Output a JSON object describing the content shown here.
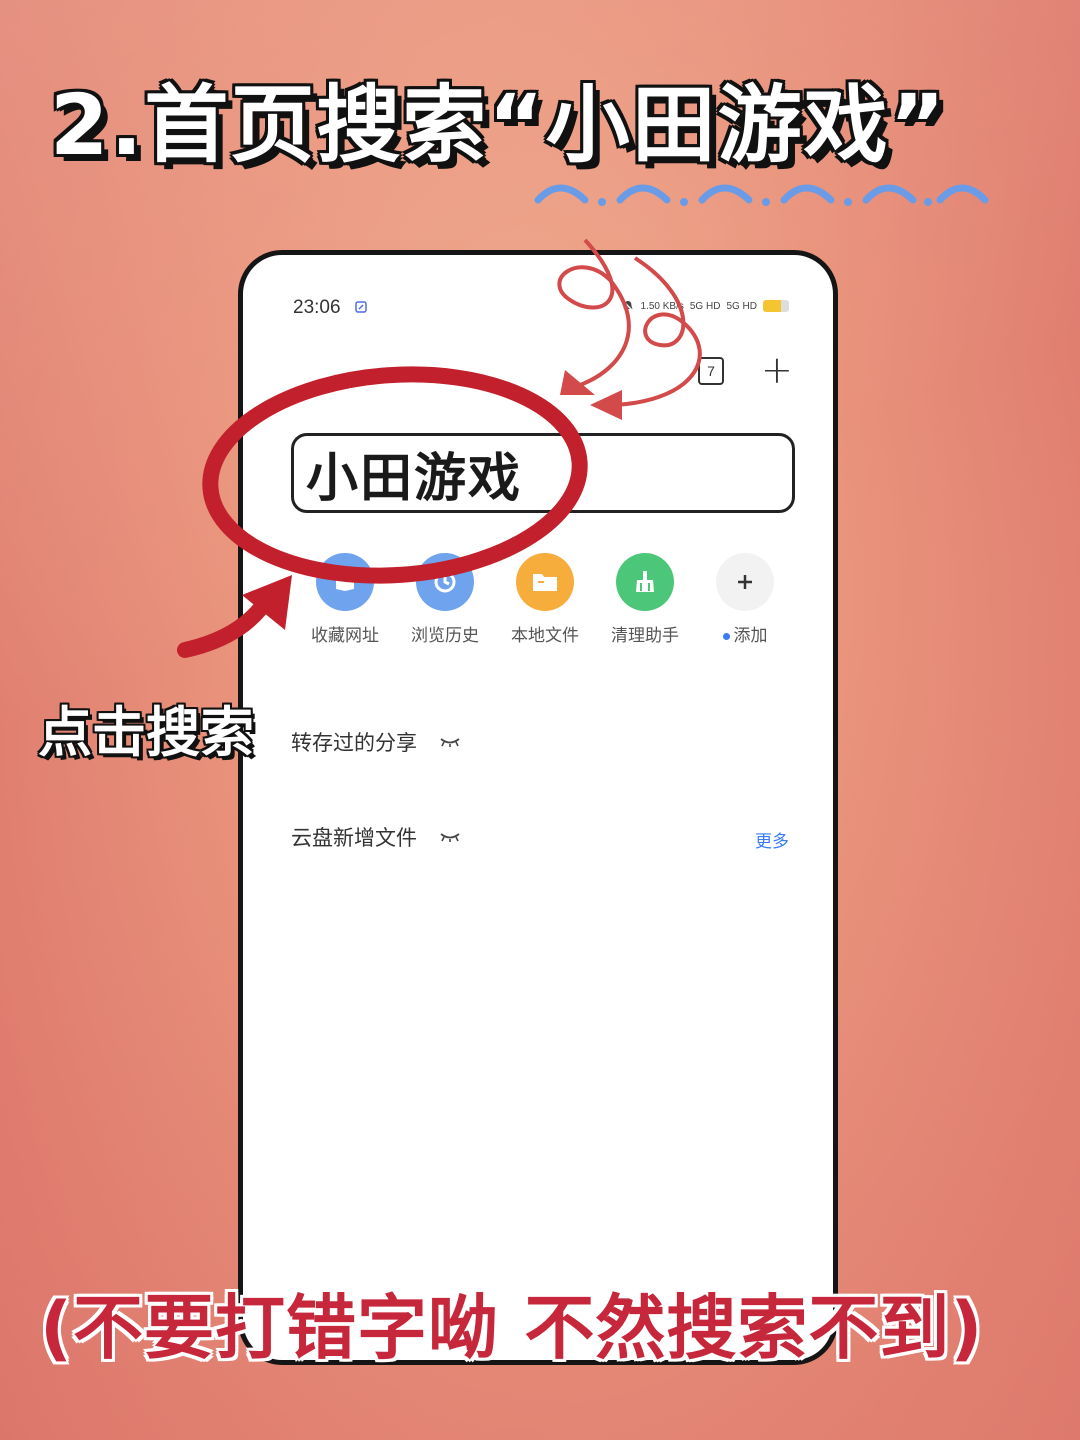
{
  "headline": {
    "title": "2.首页搜索“小田游戏”",
    "side_note": "点击搜索",
    "warning": "(不要打错字呦  不然搜索不到)"
  },
  "status_bar": {
    "time": "23:06",
    "net_speed": "1.50 KB/s",
    "sim1": "5G HD",
    "sim2": "5G HD"
  },
  "toolbar": {
    "tab_count": "7",
    "new_tab_label": "+"
  },
  "search": {
    "value": "小田游戏"
  },
  "quick_links": [
    {
      "label": "收藏网址",
      "icon": "bookmark-icon",
      "color": "#6fa3ee"
    },
    {
      "label": "浏览历史",
      "icon": "history-icon",
      "color": "#6fa3ee"
    },
    {
      "label": "本地文件",
      "icon": "folder-icon",
      "color": "#f6ad3c"
    },
    {
      "label": "清理助手",
      "icon": "broom-icon",
      "color": "#4cc77a"
    },
    {
      "label": "添加",
      "icon": "plus-icon",
      "color": "#f2f2f2"
    }
  ],
  "sections": {
    "shared": {
      "label": "转存过的分享"
    },
    "cloud": {
      "label": "云盘新增文件",
      "more": "更多"
    }
  },
  "colors": {
    "circle": "#c2202c",
    "arrow": "#c2202c",
    "accent_blue": "#3a7cf2",
    "wave": "#6a9be6"
  }
}
